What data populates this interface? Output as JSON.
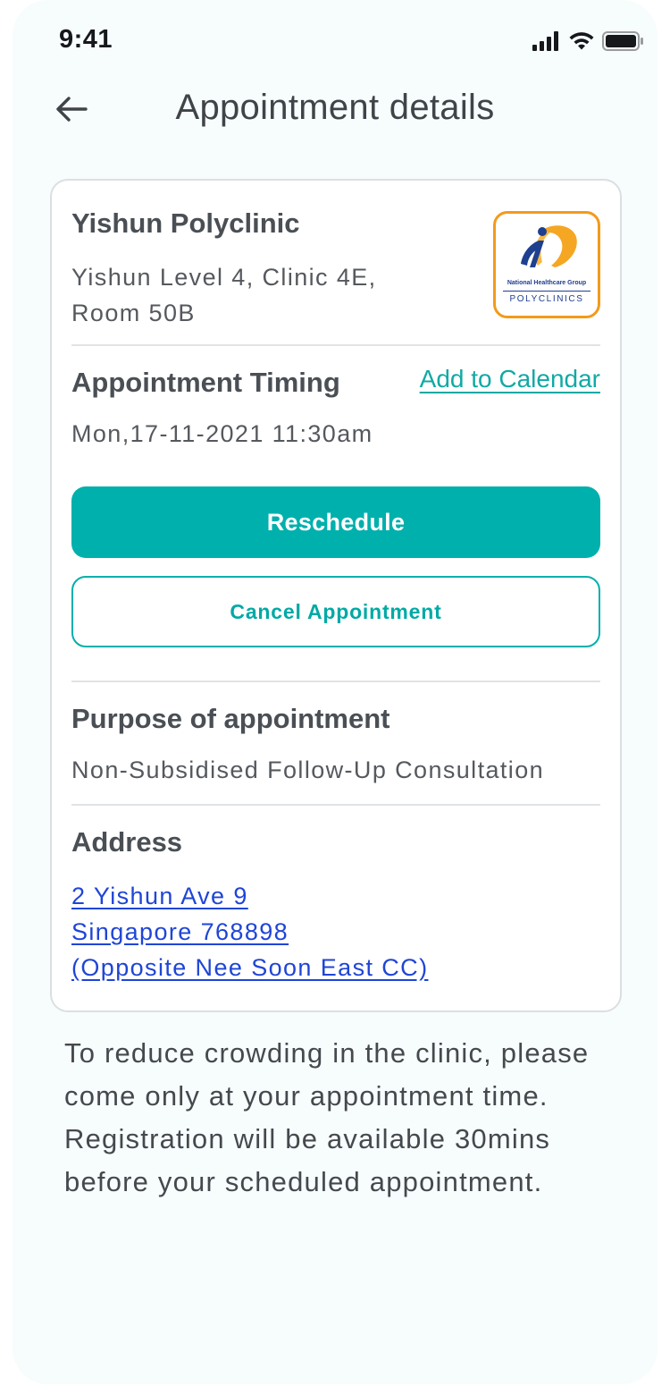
{
  "status_bar": {
    "time": "9:41"
  },
  "header": {
    "title": "Appointment details",
    "back_icon": "arrow-left-icon"
  },
  "clinic": {
    "name": "Yishun Polyclinic",
    "location_line1": "Yishun Level 4, Clinic 4E,",
    "location_line2": "Room 50B",
    "logo": {
      "org": "National Healthcare Group",
      "label": "POLYCLINICS",
      "border_color": "#f39a1b",
      "primary_color": "#1f3f8f"
    }
  },
  "timing": {
    "label": "Appointment Timing",
    "add_to_calendar": "Add to Calendar",
    "value": "Mon,17-11-2021 11:30am"
  },
  "actions": {
    "reschedule": "Reschedule",
    "cancel": "Cancel Appointment"
  },
  "purpose": {
    "label": "Purpose of appointment",
    "value": "Non-Subsidised Follow-Up Consultation"
  },
  "address": {
    "label": "Address",
    "lines": [
      "2 Yishun Ave 9",
      "Singapore 768898",
      "(Opposite Nee Soon East CC)"
    ]
  },
  "note": "To reduce crowding in the clinic, please come only at your appointment time. Registration will be available 30mins before your scheduled appointment.",
  "colors": {
    "accent": "#00b0ad",
    "link": "#1f45d6",
    "background": "#f7fcfc"
  }
}
